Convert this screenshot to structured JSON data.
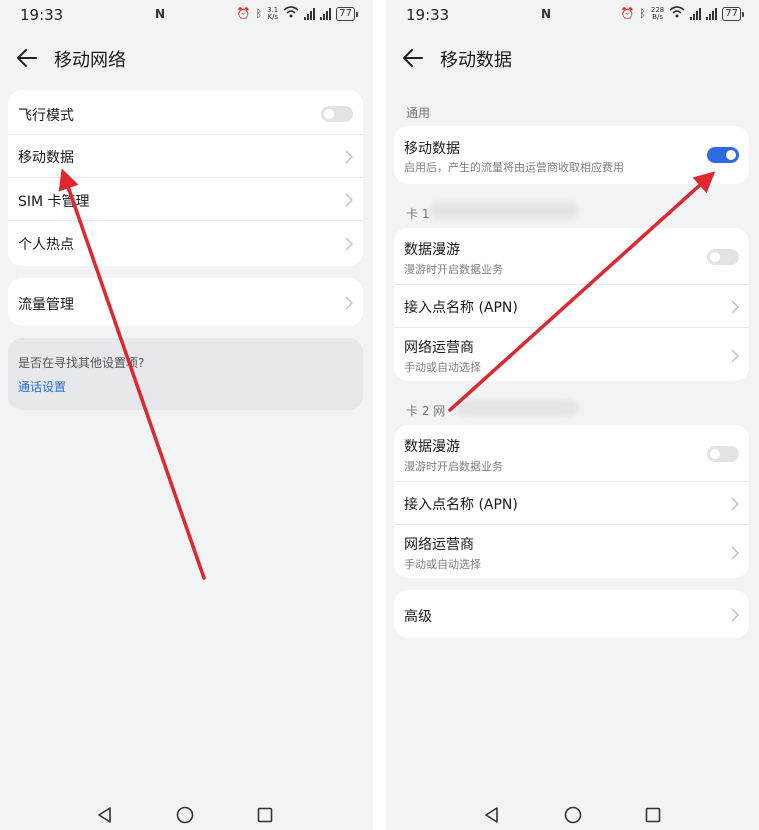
{
  "status_bar": {
    "time": "19:33",
    "battery": "77",
    "left_speed_value": "3.1",
    "left_speed_unit": "K/s",
    "right_speed_value": "228",
    "right_speed_unit": "B/s"
  },
  "left_screen": {
    "title": "移动网络",
    "items": [
      {
        "label": "飞行模式",
        "control": "toggle",
        "on": false
      },
      {
        "label": "移动数据",
        "control": "chevron"
      },
      {
        "label": "SIM 卡管理",
        "control": "chevron"
      },
      {
        "label": "个人热点",
        "control": "chevron"
      }
    ],
    "traffic": {
      "label": "流量管理"
    },
    "help": {
      "question": "是否在寻找其他设置项?",
      "link": "通话设置"
    }
  },
  "right_screen": {
    "title": "移动数据",
    "section_general": "通用",
    "mobile_data": {
      "label": "移动数据",
      "sub": "启用后，产生的流量将由运营商收取相应费用",
      "on": true
    },
    "card1": {
      "header": "卡 1",
      "roaming": {
        "label": "数据漫游",
        "sub": "漫游时开启数据业务",
        "on": false
      },
      "apn": {
        "label": "接入点名称 (APN)"
      },
      "operator": {
        "label": "网络运营商",
        "sub": "手动或自动选择"
      }
    },
    "card2": {
      "header": "卡 2 网",
      "roaming": {
        "label": "数据漫游",
        "sub": "漫游时开启数据业务",
        "on": false
      },
      "apn": {
        "label": "接入点名称 (APN)"
      },
      "operator": {
        "label": "网络运营商",
        "sub": "手动或自动选择"
      }
    },
    "advanced": {
      "label": "高级"
    }
  },
  "icons": {
    "back": "arrow-left-icon",
    "chevron": "chevron-right-icon",
    "nav_back": "triangle-back-icon",
    "nav_home": "circle-home-icon",
    "nav_recents": "square-recents-icon"
  },
  "colors": {
    "accent": "#2d6be4",
    "annotation_arrow": "#e0262e",
    "background": "#f1f3f5"
  }
}
